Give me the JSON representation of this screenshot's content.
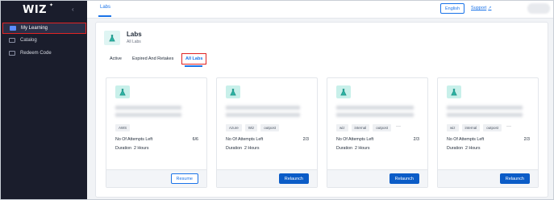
{
  "app": {
    "logo": "WIZ"
  },
  "sidebar": {
    "items": [
      {
        "label": "My Learning",
        "icon": "learning-icon",
        "active": true
      },
      {
        "label": "Catalog",
        "icon": "catalog-icon",
        "active": false
      },
      {
        "label": "Redeem Code",
        "icon": "redeem-icon",
        "active": false
      }
    ]
  },
  "topbar": {
    "tab": "Labs",
    "language": "English",
    "support": "Support"
  },
  "page": {
    "title": "Labs",
    "subtitle": "All Labs",
    "tabs": [
      "Active",
      "Expired And Retakes",
      "All Labs"
    ],
    "active_tab": "All Labs"
  },
  "cards": [
    {
      "chips": [
        "AWS"
      ],
      "more": "",
      "attempts_label": "No Of Attempts Left",
      "attempts": "6/6",
      "duration_label": "Duration",
      "duration": "2 Hours",
      "button": "Resume",
      "button_style": "outline"
    },
    {
      "chips": [
        "Azure",
        "Wiz",
        "outpost"
      ],
      "more": "",
      "attempts_label": "No Of Attempts Left",
      "attempts": "2/3",
      "duration_label": "Duration",
      "duration": "2 Hours",
      "button": "Relaunch",
      "button_style": "solid"
    },
    {
      "chips": [
        "wiz",
        "internal",
        "outpost"
      ],
      "more": "···",
      "attempts_label": "No Of Attempts Left",
      "attempts": "2/3",
      "duration_label": "Duration",
      "duration": "2 Hours",
      "button": "Relaunch",
      "button_style": "solid"
    },
    {
      "chips": [
        "wiz",
        "internal",
        "outpost"
      ],
      "more": "···",
      "attempts_label": "No Of Attempts Left",
      "attempts": "2/3",
      "duration_label": "Duration",
      "duration": "2 Hours",
      "button": "Relaunch",
      "button_style": "solid"
    }
  ],
  "colors": {
    "sidebar_bg": "#1a1d2c",
    "accent": "#1a73e8",
    "button_solid": "#0b5cc7",
    "highlight_border": "#e02424",
    "icon_tile": "#c8f0ea"
  }
}
